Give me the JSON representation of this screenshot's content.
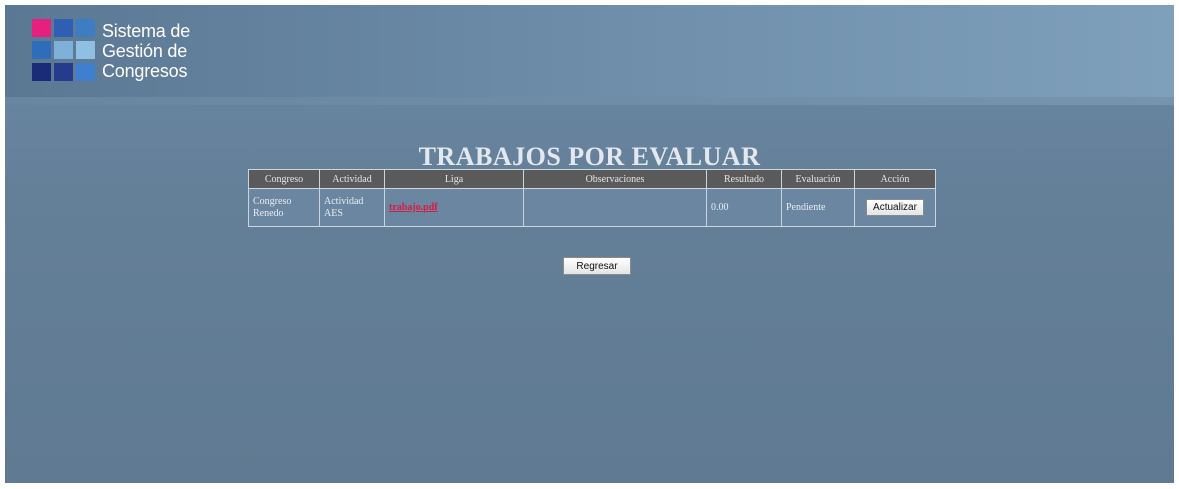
{
  "app": {
    "logo_lines": [
      "Sistema de",
      "Gestión de",
      "Congresos"
    ],
    "logo_colors": [
      "#e6207e",
      "#2f5fb4",
      "#3c7dc3",
      "#7fb0d8",
      "#1f3f8c",
      "#2f6cbb",
      "#8fbfe2",
      "#1a2b78",
      "#263a8e",
      "#3f7fcf"
    ]
  },
  "page": {
    "title": "TRABAJOS POR EVALUAR"
  },
  "table": {
    "headers": [
      "Congreso",
      "Actividad",
      "Liga",
      "Observaciones",
      "Resultado",
      "Evaluación",
      "Acción"
    ],
    "rows": [
      {
        "congreso": "Congreso Renedo",
        "actividad": "Actividad AES",
        "liga": "trabajo.pdf",
        "observaciones": "",
        "resultado": "0.00",
        "evaluacion": "Pendiente",
        "accion_label": "Actualizar"
      }
    ]
  },
  "actions": {
    "back_label": "Regresar"
  }
}
